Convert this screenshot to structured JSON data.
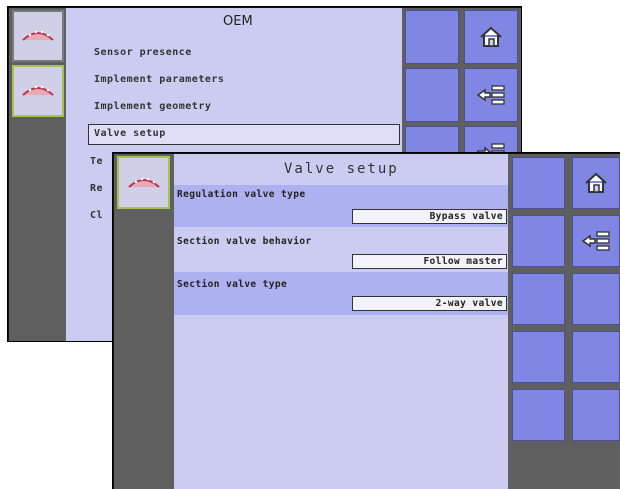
{
  "back_screen": {
    "title": "OEM",
    "menu_items": [
      {
        "label": "Sensor presence"
      },
      {
        "label": "Implement parameters"
      },
      {
        "label": "Implement geometry"
      },
      {
        "label": "Valve setup",
        "selected": true
      },
      {
        "label": "Te"
      },
      {
        "label": "Re"
      },
      {
        "label": "Cl"
      }
    ],
    "side_buttons": [
      "home-icon",
      "back-list-icon",
      "forward-list-icon"
    ]
  },
  "front_screen": {
    "title": "Valve setup",
    "fields": [
      {
        "label": "Regulation valve type",
        "value": "Bypass valve",
        "highlighted": true
      },
      {
        "label": "Section valve behavior",
        "value": "Follow master",
        "highlighted": false
      },
      {
        "label": "Section valve type",
        "value": "2-way valve",
        "highlighted": true
      }
    ],
    "side_buttons": [
      "home-icon",
      "back-list-icon"
    ]
  },
  "colors": {
    "content_bg": "#ccccf2",
    "highlight_row": "#adb1ef",
    "side_button": "#7f86e4",
    "rail": "#5f5f5f",
    "active_tab_border": "#a6c44a"
  }
}
